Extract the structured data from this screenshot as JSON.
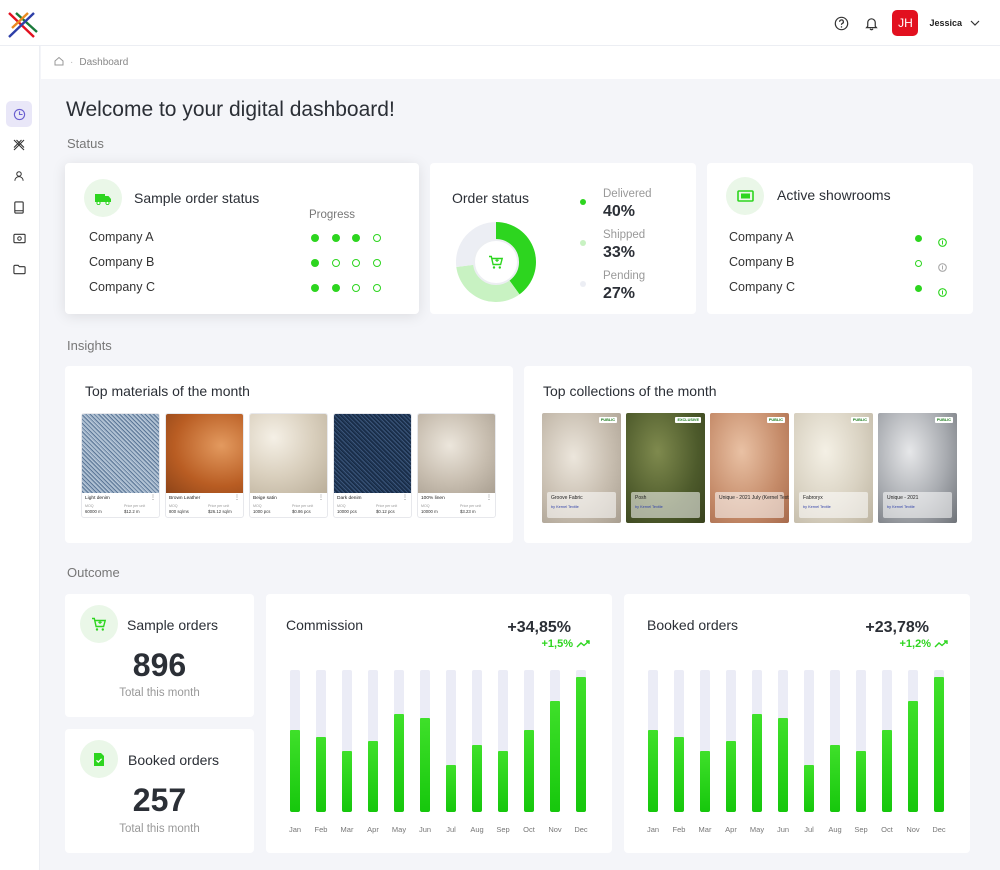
{
  "colors": {
    "accent": "#2dd51f",
    "accent_light": "#c8f2c2",
    "brand_red": "#e2101f",
    "active_nav": "#e9e7f8"
  },
  "header": {
    "icons": [
      "help-icon",
      "bell-icon"
    ],
    "user": {
      "initials": "JH",
      "name": "Jessica"
    }
  },
  "sidebar": {
    "items": [
      {
        "icon": "dashboard-icon",
        "active": true
      },
      {
        "icon": "materials-icon",
        "active": false
      },
      {
        "icon": "user-icon",
        "active": false
      },
      {
        "icon": "book-icon",
        "active": false
      },
      {
        "icon": "showroom-icon",
        "active": false
      },
      {
        "icon": "folder-icon",
        "active": false
      }
    ]
  },
  "breadcrumb": {
    "current": "Dashboard"
  },
  "page": {
    "title": "Welcome to your digital dashboard!"
  },
  "sections": {
    "status": "Status",
    "insights": "Insights",
    "outcome": "Outcome"
  },
  "sample_order_status": {
    "title": "Sample order status",
    "progress_label": "Progress",
    "rows": [
      {
        "name": "Company A",
        "progress": [
          1,
          1,
          1,
          0
        ]
      },
      {
        "name": "Company B",
        "progress": [
          1,
          0,
          0,
          0
        ]
      },
      {
        "name": "Company C",
        "progress": [
          1,
          1,
          0,
          0
        ]
      }
    ]
  },
  "order_status": {
    "title": "Order status",
    "items": [
      {
        "name": "Delivered",
        "value": "40%",
        "percent": 40,
        "color": "#2dd51f"
      },
      {
        "name": "Shipped",
        "value": "33%",
        "percent": 33,
        "color": "#c8f2c2"
      },
      {
        "name": "Pending",
        "value": "27%",
        "percent": 27,
        "color": "#eceef4"
      }
    ]
  },
  "active_showrooms": {
    "title": "Active showrooms",
    "rows": [
      {
        "name": "Company A",
        "active": true
      },
      {
        "name": "Company B",
        "active": false
      },
      {
        "name": "Company C",
        "active": true
      }
    ]
  },
  "top_materials": {
    "title": "Top materials of the month",
    "meta_label_1": "MOQ",
    "meta_label_2": "Price per unit",
    "items": [
      {
        "name": "Light denim",
        "moq": "60000 m",
        "price": "$12.2 m",
        "swatch": "denim-light"
      },
      {
        "name": "Brown Leather",
        "moq": "800 sq/ms",
        "price": "$26.12 sq/m",
        "swatch": "leather"
      },
      {
        "name": "Beige satin",
        "moq": "1000 pcs",
        "price": "$0.86 pcs",
        "swatch": "satin"
      },
      {
        "name": "Dark denim",
        "moq": "10000 pcs",
        "price": "$0.12 pcs",
        "swatch": "denim-dark"
      },
      {
        "name": "100% linen",
        "moq": "10000 m",
        "price": "$3.23 m",
        "swatch": "linen"
      }
    ]
  },
  "top_collections": {
    "title": "Top collections of the month",
    "items": [
      {
        "name": "Groove Fabric",
        "by": "by Kernel Textile",
        "badge": "PUBLIC",
        "swatch": "c-cream"
      },
      {
        "name": "Posh",
        "by": "by Kernel Textile",
        "badge": "EXCLUSIVE",
        "swatch": "c-olive"
      },
      {
        "name": "Unique - 2021 July (Kernel Textile)",
        "by": "",
        "badge": "PUBLIC",
        "swatch": "c-copper"
      },
      {
        "name": "Fabroryx",
        "by": "by Kernel Textile",
        "badge": "PUBLIC",
        "swatch": "c-ivory"
      },
      {
        "name": "Unique - 2021",
        "by": "by Kernel Textile",
        "badge": "PUBLIC",
        "swatch": "c-grey"
      }
    ]
  },
  "outcome": {
    "sample_orders": {
      "title": "Sample orders",
      "value": "896",
      "label": "Total this month"
    },
    "booked_orders": {
      "title": "Booked orders",
      "value": "257",
      "label": "Total this month"
    }
  },
  "chart_data": [
    {
      "type": "bar",
      "title": "Commission",
      "change": "+34,85%",
      "change_sub": "+1,5%",
      "categories": [
        "Jan",
        "Feb",
        "Mar",
        "Apr",
        "May",
        "Jun",
        "Jul",
        "Aug",
        "Sep",
        "Oct",
        "Nov",
        "Dec"
      ],
      "values": [
        58,
        53,
        43,
        50,
        69,
        66,
        33,
        47,
        43,
        58,
        78,
        95
      ],
      "ylim": [
        0,
        100
      ]
    },
    {
      "type": "bar",
      "title": "Booked orders",
      "change": "+23,78%",
      "change_sub": "+1,2%",
      "categories": [
        "Jan",
        "Feb",
        "Mar",
        "Apr",
        "May",
        "Jun",
        "Jul",
        "Aug",
        "Sep",
        "Oct",
        "Nov",
        "Dec"
      ],
      "values": [
        58,
        53,
        43,
        50,
        69,
        66,
        33,
        47,
        43,
        58,
        78,
        95
      ],
      "ylim": [
        0,
        100
      ]
    }
  ]
}
